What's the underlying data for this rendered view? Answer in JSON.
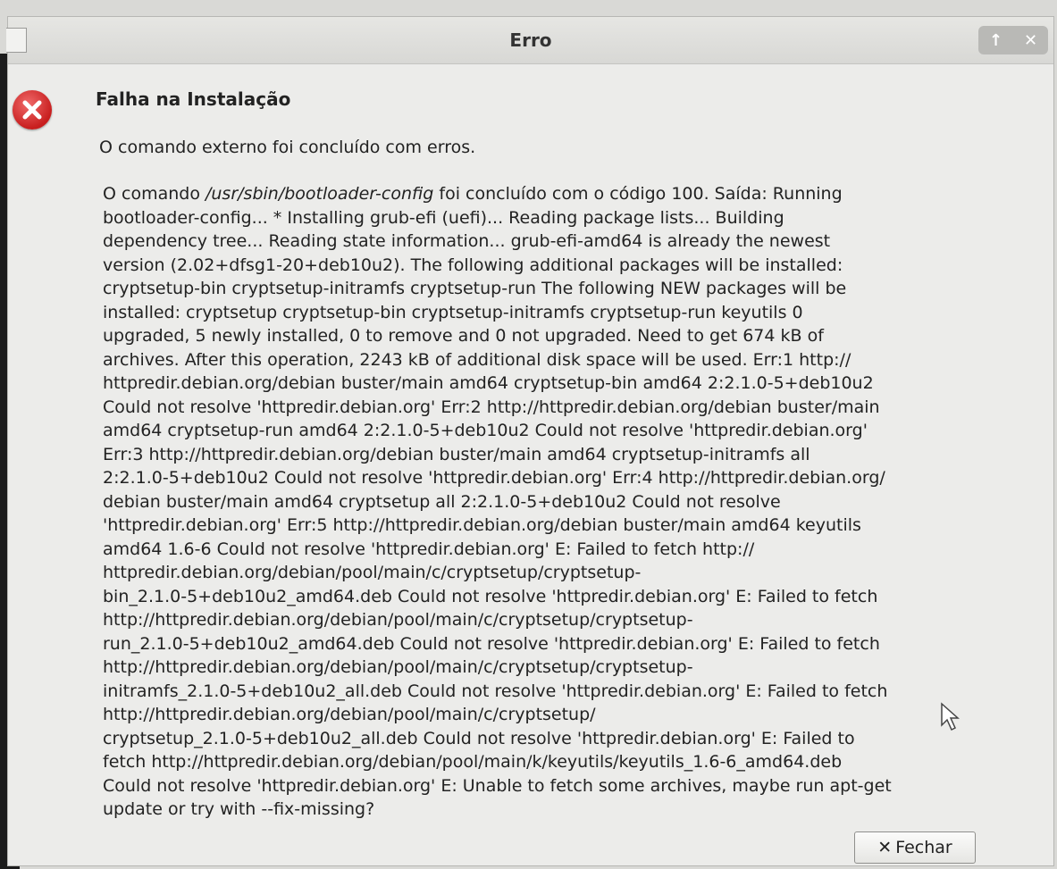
{
  "window": {
    "title": "Erro",
    "maximize_glyph": "↑",
    "close_glyph": "✕"
  },
  "dialog": {
    "heading": "Falha na Instalação",
    "subtitle": "O comando externo foi concluído com erros.",
    "details_prefix": "O comando ",
    "details_command": "/usr/sbin/bootloader-config",
    "details_rest": " foi concluído com o código 100. Saída: Running\nbootloader-config... * Installing grub-efi (uefi)... Reading package lists... Building\ndependency tree... Reading state information... grub-efi-amd64 is already the newest\nversion (2.02+dfsg1-20+deb10u2). The following additional packages will be installed:\ncryptsetup-bin cryptsetup-initramfs cryptsetup-run The following NEW packages will be\ninstalled: cryptsetup cryptsetup-bin cryptsetup-initramfs cryptsetup-run keyutils 0\nupgraded, 5 newly installed, 0 to remove and 0 not upgraded. Need to get 674 kB of\narchives. After this operation, 2243 kB of additional disk space will be used. Err:1 http://\nhttpredir.debian.org/debian buster/main amd64 cryptsetup-bin amd64 2:2.1.0-5+deb10u2\nCould not resolve 'httpredir.debian.org' Err:2 http://httpredir.debian.org/debian buster/main\namd64 cryptsetup-run amd64 2:2.1.0-5+deb10u2 Could not resolve 'httpredir.debian.org'\nErr:3 http://httpredir.debian.org/debian buster/main amd64 cryptsetup-initramfs all\n2:2.1.0-5+deb10u2 Could not resolve 'httpredir.debian.org' Err:4 http://httpredir.debian.org/\ndebian buster/main amd64 cryptsetup all 2:2.1.0-5+deb10u2 Could not resolve\n'httpredir.debian.org' Err:5 http://httpredir.debian.org/debian buster/main amd64 keyutils\namd64 1.6-6 Could not resolve 'httpredir.debian.org' E: Failed to fetch http://\nhttpredir.debian.org/debian/pool/main/c/cryptsetup/cryptsetup-\nbin_2.1.0-5+deb10u2_amd64.deb Could not resolve 'httpredir.debian.org' E: Failed to fetch\nhttp://httpredir.debian.org/debian/pool/main/c/cryptsetup/cryptsetup-\nrun_2.1.0-5+deb10u2_amd64.deb Could not resolve 'httpredir.debian.org' E: Failed to fetch\nhttp://httpredir.debian.org/debian/pool/main/c/cryptsetup/cryptsetup-\ninitramfs_2.1.0-5+deb10u2_all.deb Could not resolve 'httpredir.debian.org' E: Failed to fetch\nhttp://httpredir.debian.org/debian/pool/main/c/cryptsetup/\ncryptsetup_2.1.0-5+deb10u2_all.deb Could not resolve 'httpredir.debian.org' E: Failed to\nfetch http://httpredir.debian.org/debian/pool/main/k/keyutils/keyutils_1.6-6_amd64.deb\nCould not resolve 'httpredir.debian.org' E: Unable to fetch some archives, maybe run apt-get\nupdate or try with --fix-missing?",
    "close_button_glyph": "✕",
    "close_button_label": "Fechar"
  },
  "icons": {
    "status_icon": "error-icon",
    "mouse_pointer": "mouse-pointer-icon"
  },
  "colors": {
    "error_red": "#d42a2a",
    "dialog_background": "#ececea"
  }
}
